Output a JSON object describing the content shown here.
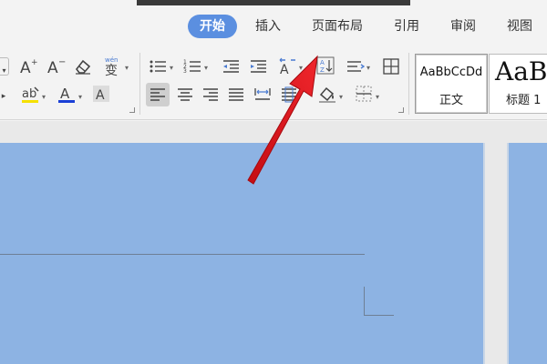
{
  "menu": {
    "tabs": [
      {
        "label": "开始",
        "active": true
      },
      {
        "label": "插入"
      },
      {
        "label": "页面布局"
      },
      {
        "label": "引用"
      },
      {
        "label": "审阅"
      },
      {
        "label": "视图"
      }
    ]
  },
  "ribbon": {
    "font_group": {
      "icons": [
        "increase-font-size-icon",
        "decrease-font-size-icon",
        "clear-formatting-icon",
        "phonetic-guide-icon",
        "highlight-color-icon",
        "font-color-icon",
        "character-shading-icon"
      ],
      "phonetic_glyph": "wén",
      "highlight_color": "#f5e000",
      "font_color": "#1a3fd6"
    },
    "paragraph_group": {
      "icons": [
        "bullets-icon",
        "numbering-icon",
        "decrease-indent-icon",
        "increase-indent-icon",
        "text-direction-icon",
        "sort-icon",
        "line-spacing-icon",
        "borders-table-icon",
        "align-left-icon",
        "align-center-icon",
        "align-right-icon",
        "justify-icon",
        "distributed-icon",
        "paragraph-spacing-icon",
        "shading-icon",
        "borders-icon"
      ]
    },
    "styles": [
      {
        "sample": "AaBbCcDd",
        "name": "正文",
        "selected": true
      },
      {
        "sample": "AaB",
        "name": "标题 1"
      }
    ]
  },
  "annotation": {
    "arrow_color": "#e8141b",
    "points_to": "sort-icon"
  }
}
